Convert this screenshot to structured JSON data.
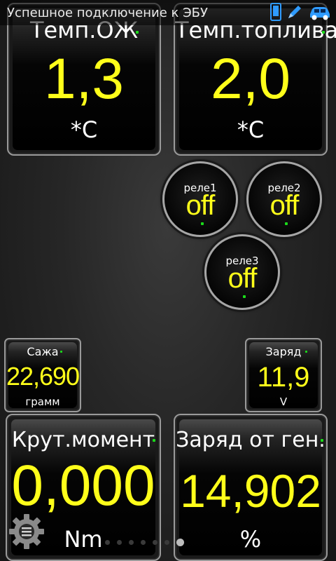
{
  "status": {
    "text": "Успешное подключение к ЭБУ",
    "icons": [
      "phone-icon",
      "pen-icon",
      "car-icon"
    ]
  },
  "colors": {
    "value": "#ffff1a",
    "indicator": "#1adb1a",
    "border": "#9a9a9a"
  },
  "gauges": {
    "coolant": {
      "title": "Темп.ОЖ",
      "value": "1,3",
      "unit": "*C"
    },
    "fuel": {
      "title": "Темп.топлива",
      "value": "2,0",
      "unit": "*C"
    },
    "soot": {
      "title": "Сажа",
      "value": "22,690",
      "unit": "грамм"
    },
    "charge": {
      "title": "Заряд",
      "value": "11,9",
      "unit": "V"
    },
    "torque": {
      "title": "Крут.момент",
      "value": "0,000",
      "unit": "Nm"
    },
    "generator": {
      "title": "Заряд от ген.",
      "value": "14,902",
      "unit": "%"
    }
  },
  "relays": [
    {
      "label": "реле1",
      "value": "off"
    },
    {
      "label": "реле2",
      "value": "off"
    },
    {
      "label": "реле3",
      "value": "off"
    }
  ],
  "pager": {
    "count": 7,
    "active": 6
  }
}
